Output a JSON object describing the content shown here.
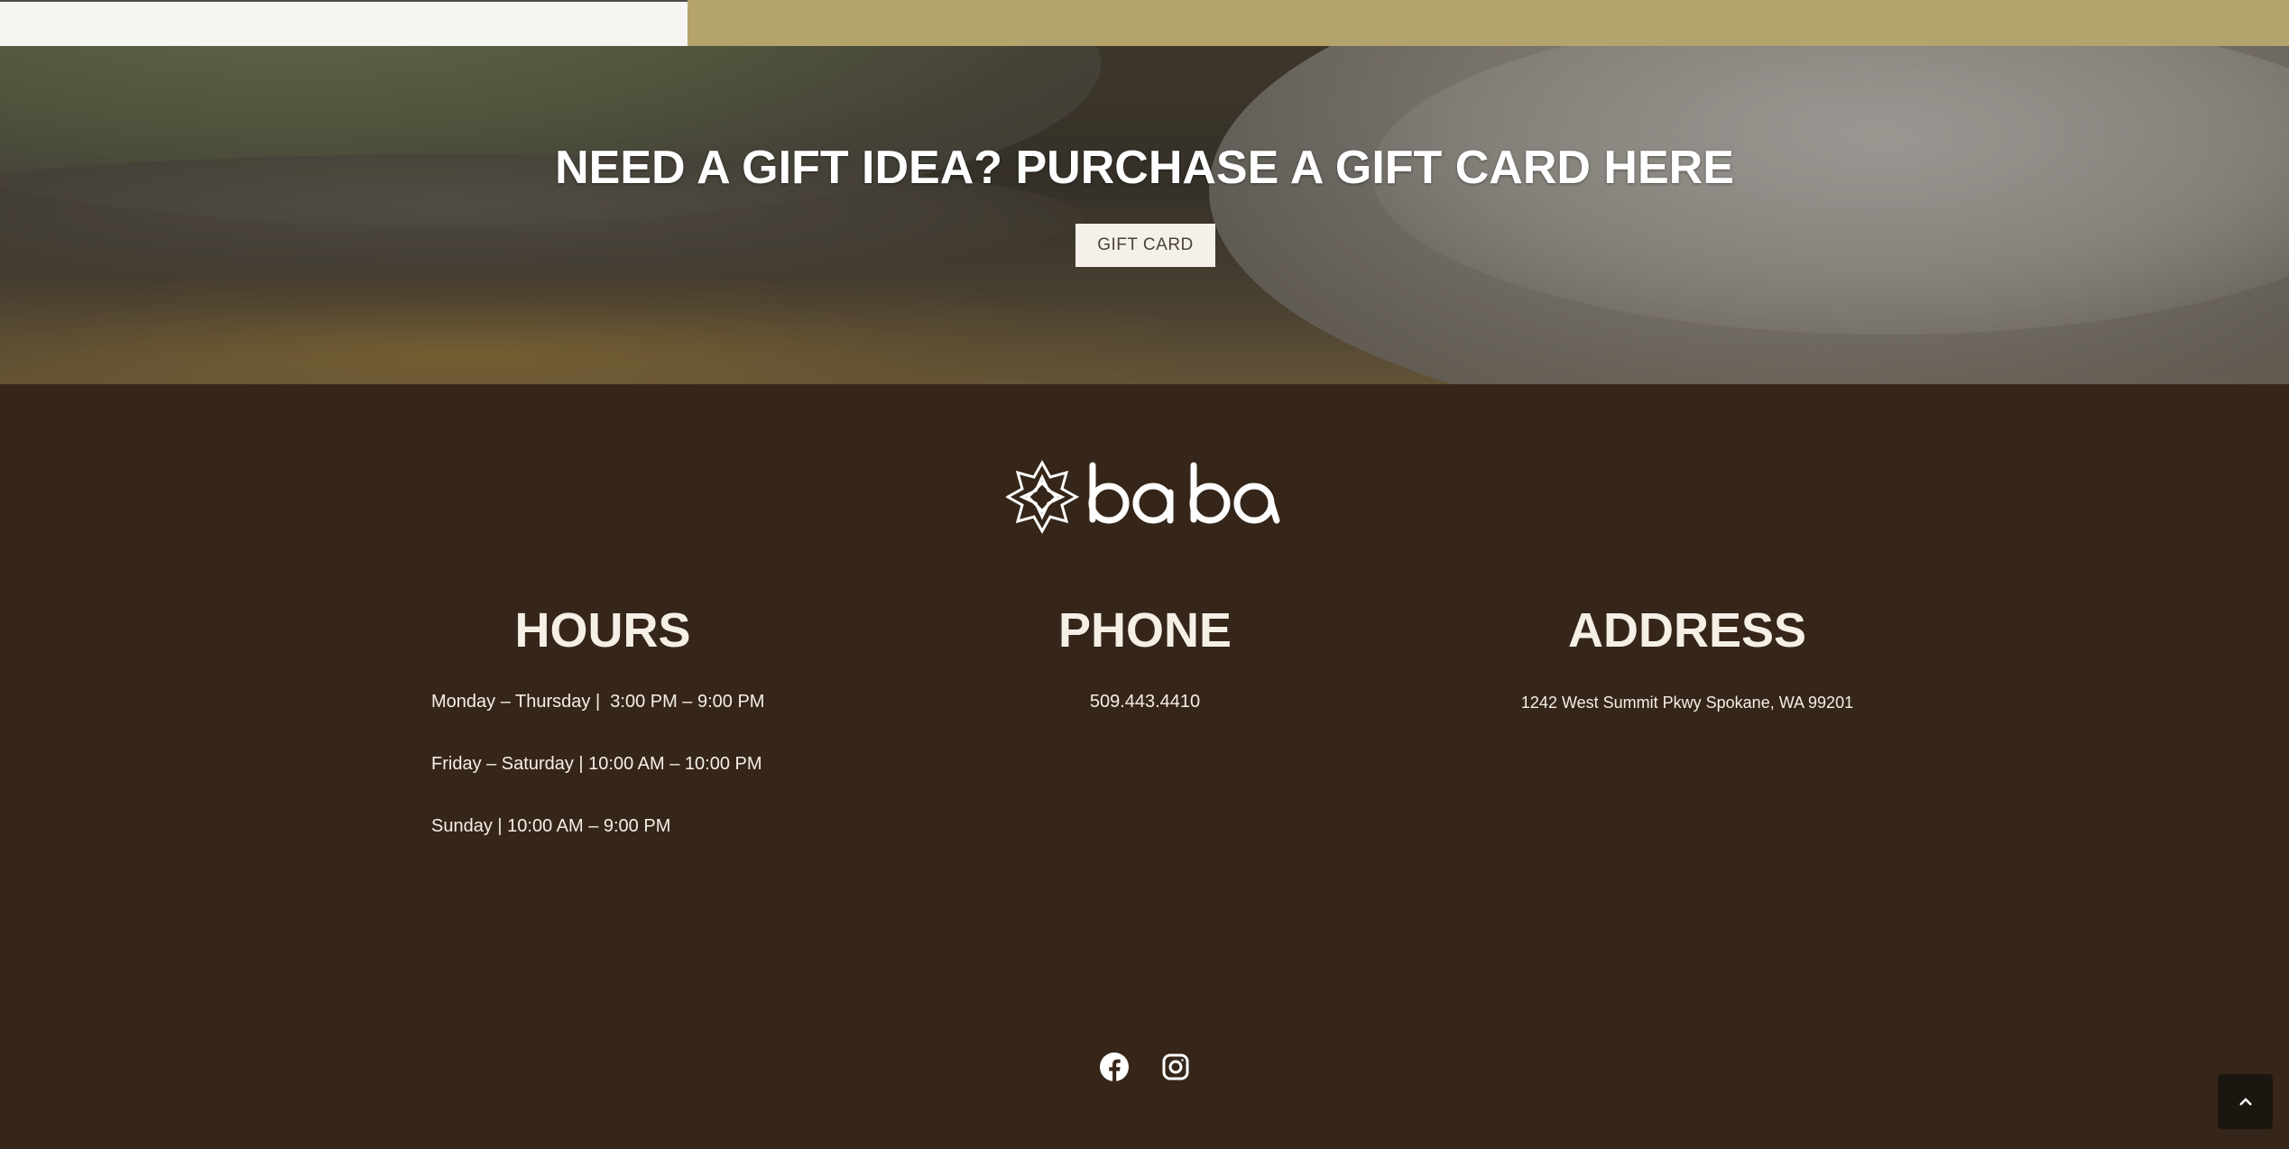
{
  "hero": {
    "title": "NEED A GIFT IDEA? PURCHASE A GIFT CARD HERE",
    "button_label": "GIFT CARD"
  },
  "footer": {
    "logo_text": "baba",
    "hours": {
      "title": "HOURS",
      "lines": [
        "Monday – Thursday |  3:00 PM – 9:00 PM",
        "Friday – Saturday | 10:00 AM – 10:00 PM",
        "Sunday | 10:00 AM – 9:00 PM"
      ]
    },
    "phone": {
      "title": "PHONE",
      "number": "509.443.4410"
    },
    "address": {
      "title": "ADDRESS",
      "text": "1242 West Summit Pkwy Spokane, WA 99201"
    },
    "social": [
      "facebook-icon",
      "instagram-icon"
    ]
  },
  "back_to_top": "chevron-up-icon",
  "colors": {
    "footer_bg": "#352619",
    "accent_gold": "#b4a36a",
    "text_cream": "#f5efe6"
  }
}
